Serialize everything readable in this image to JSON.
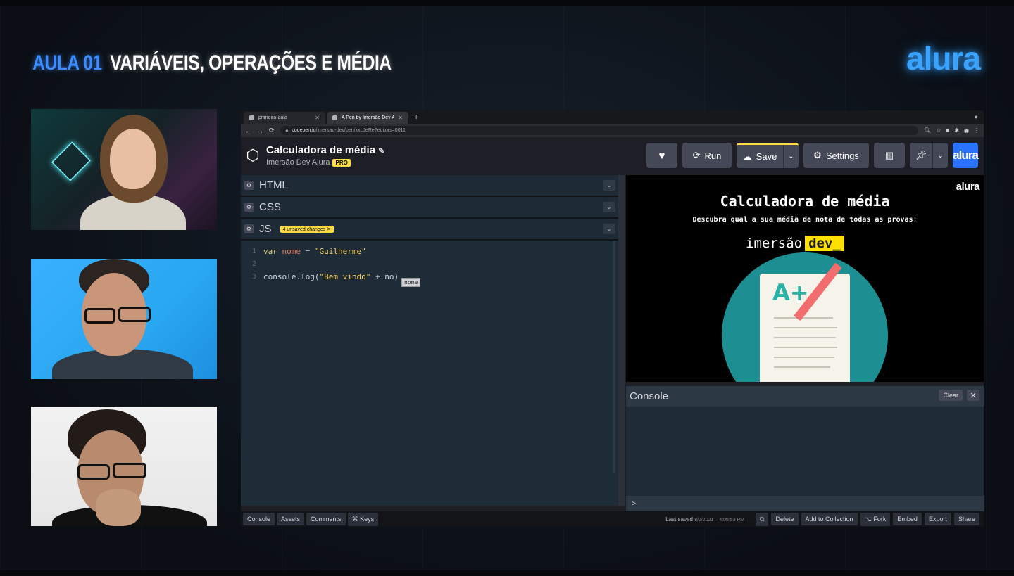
{
  "course": {
    "lesson": "AULA 01",
    "topic": "VARIÁVEIS, OPERAÇÕES E MÉDIA",
    "brand": "alura"
  },
  "browser": {
    "tabs": [
      {
        "label": "primeira-aula",
        "active": false
      },
      {
        "label": "A Pen by Imersão Dev Alura",
        "active": true
      }
    ],
    "url_host": "codepen.io",
    "url_path": "/imersao-dev/pen/xxLJeRe?editors=0011"
  },
  "codepen": {
    "pen_title": "Calculadora de média",
    "owner": "Imersão Dev Alura",
    "pro_label": "PRO",
    "actions": {
      "run": "Run",
      "save": "Save",
      "settings": "Settings",
      "alura": "alura"
    },
    "editors": {
      "html": "HTML",
      "css": "CSS",
      "js": "JS",
      "unsaved": "4 unsaved changes ✕"
    },
    "code_lines": [
      {
        "num": "1"
      },
      {
        "num": "2"
      },
      {
        "num": "3"
      }
    ],
    "code": {
      "l1_kw": "var",
      "l1_var": "nome",
      "l1_op": "=",
      "l1_str": "\"Guilherme\"",
      "l3_fn": "console.log(",
      "l3_str": "\"Bem vindo\"",
      "l3_op": "+",
      "l3_tail": "no)"
    },
    "autocomplete": "nome",
    "preview": {
      "brand": "alura",
      "title": "Calculadora de média",
      "subtitle": "Descubra qual a sua média de nota de todas as provas!",
      "logo_word": "imersão",
      "logo_highlight": "dev_",
      "grade": "A+"
    },
    "console": {
      "title": "Console",
      "clear": "Clear",
      "prompt": ">"
    },
    "footer": {
      "left": [
        "Console",
        "Assets",
        "Comments",
        "⌘ Keys"
      ],
      "last_saved_label": "Last saved",
      "last_saved_time": "8/2/2021 – 4:05:53 PM",
      "right": [
        "Delete",
        "Add to Collection",
        "⌥ Fork",
        "Embed",
        "Export",
        "Share"
      ]
    }
  }
}
